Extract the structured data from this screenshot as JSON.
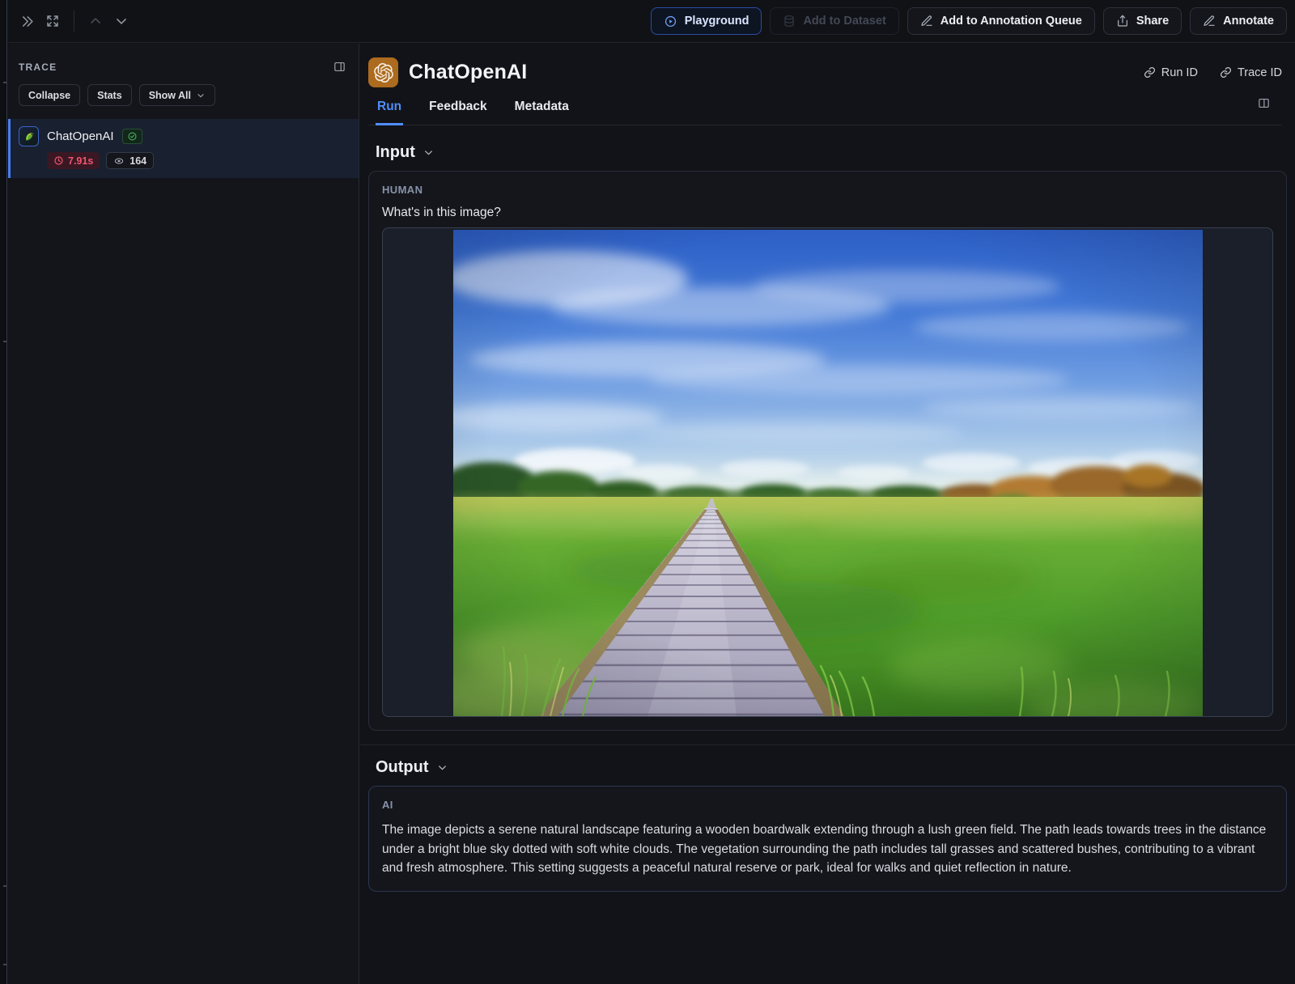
{
  "toolbar": {
    "playground": "Playground",
    "add_to_dataset": "Add to Dataset",
    "add_to_annotation_queue": "Add to Annotation Queue",
    "share": "Share",
    "annotate": "Annotate"
  },
  "sidebar": {
    "title": "TRACE",
    "collapse": "Collapse",
    "stats": "Stats",
    "show_all": "Show All"
  },
  "trace": {
    "name": "ChatOpenAI",
    "latency": "7.91s",
    "tokens": "164"
  },
  "header": {
    "title": "ChatOpenAI",
    "run_id": "Run ID",
    "trace_id": "Trace ID"
  },
  "tabs": {
    "run": "Run",
    "feedback": "Feedback",
    "metadata": "Metadata"
  },
  "input": {
    "heading": "Input",
    "role": "HUMAN",
    "question": "What's in this image?",
    "image_alt": "Photo of a wooden boardwalk leading through tall green grass toward trees under a bright blue sky with wispy clouds"
  },
  "output": {
    "heading": "Output",
    "role": "AI",
    "text": "The image depicts a serene natural landscape featuring a wooden boardwalk extending through a lush green field. The path leads towards trees in the distance under a bright blue sky dotted with soft white clouds. The vegetation surrounding the path includes tall grasses and scattered bushes, contributing to a vibrant and fresh atmosphere. This setting suggests a peaceful natural reserve or park, ideal for walks and quiet reflection in nature."
  },
  "colors": {
    "accent_blue": "#4f8ef7",
    "success_green": "#43b25c",
    "error_red": "#ef5670",
    "openai_orange": "#ac6b1e",
    "selected_row": "#192130"
  }
}
